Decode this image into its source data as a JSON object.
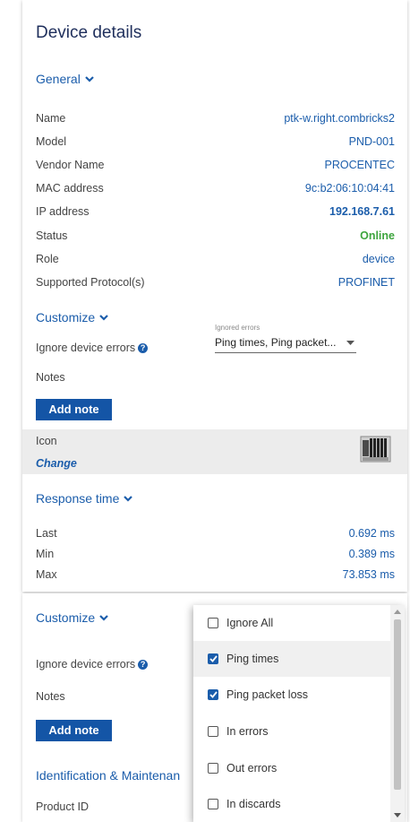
{
  "panel_title": "Device details",
  "general": {
    "heading": "General",
    "rows": [
      {
        "label": "Name",
        "value": "ptk-w.right.combricks2"
      },
      {
        "label": "Model",
        "value": "PND-001"
      },
      {
        "label": "Vendor Name",
        "value": "PROCENTEC"
      },
      {
        "label": "MAC address",
        "value": "9c:b2:06:10:04:41"
      },
      {
        "label": "IP address",
        "value": "192.168.7.61"
      },
      {
        "label": "Status",
        "value": "Online"
      },
      {
        "label": "Role",
        "value": "device"
      },
      {
        "label": "Supported Protocol(s)",
        "value": "PROFINET"
      }
    ]
  },
  "customize": {
    "heading": "Customize",
    "ignore_label": "Ignore device errors",
    "ignored_errors_caption": "Ignored errors",
    "ignored_errors_value": "Ping times, Ping packet...",
    "notes_label": "Notes",
    "add_note_label": "Add note"
  },
  "icon_section": {
    "label": "Icon",
    "change_label": "Change"
  },
  "response_time": {
    "heading": "Response time",
    "rows": [
      {
        "label": "Last",
        "value": "0.692 ms"
      },
      {
        "label": "Min",
        "value": "0.389 ms"
      },
      {
        "label": "Max",
        "value": "73.853 ms"
      }
    ]
  },
  "lower": {
    "customize_heading": "Customize",
    "ignore_label": "Ignore device errors",
    "notes_label": "Notes",
    "add_note_label": "Add note",
    "identification_heading": "Identification & Maintenan",
    "product_id_label": "Product ID"
  },
  "dropdown": {
    "options": [
      {
        "label": "Ignore All",
        "checked": false
      },
      {
        "label": "Ping times",
        "checked": true
      },
      {
        "label": "Ping packet loss",
        "checked": true
      },
      {
        "label": "In errors",
        "checked": false
      },
      {
        "label": "Out errors",
        "checked": false
      },
      {
        "label": "In discards",
        "checked": false
      }
    ]
  },
  "colors": {
    "accent": "#1b5dab",
    "title": "#1f2f5c",
    "button": "#1455a6",
    "online": "#3ea53e"
  }
}
